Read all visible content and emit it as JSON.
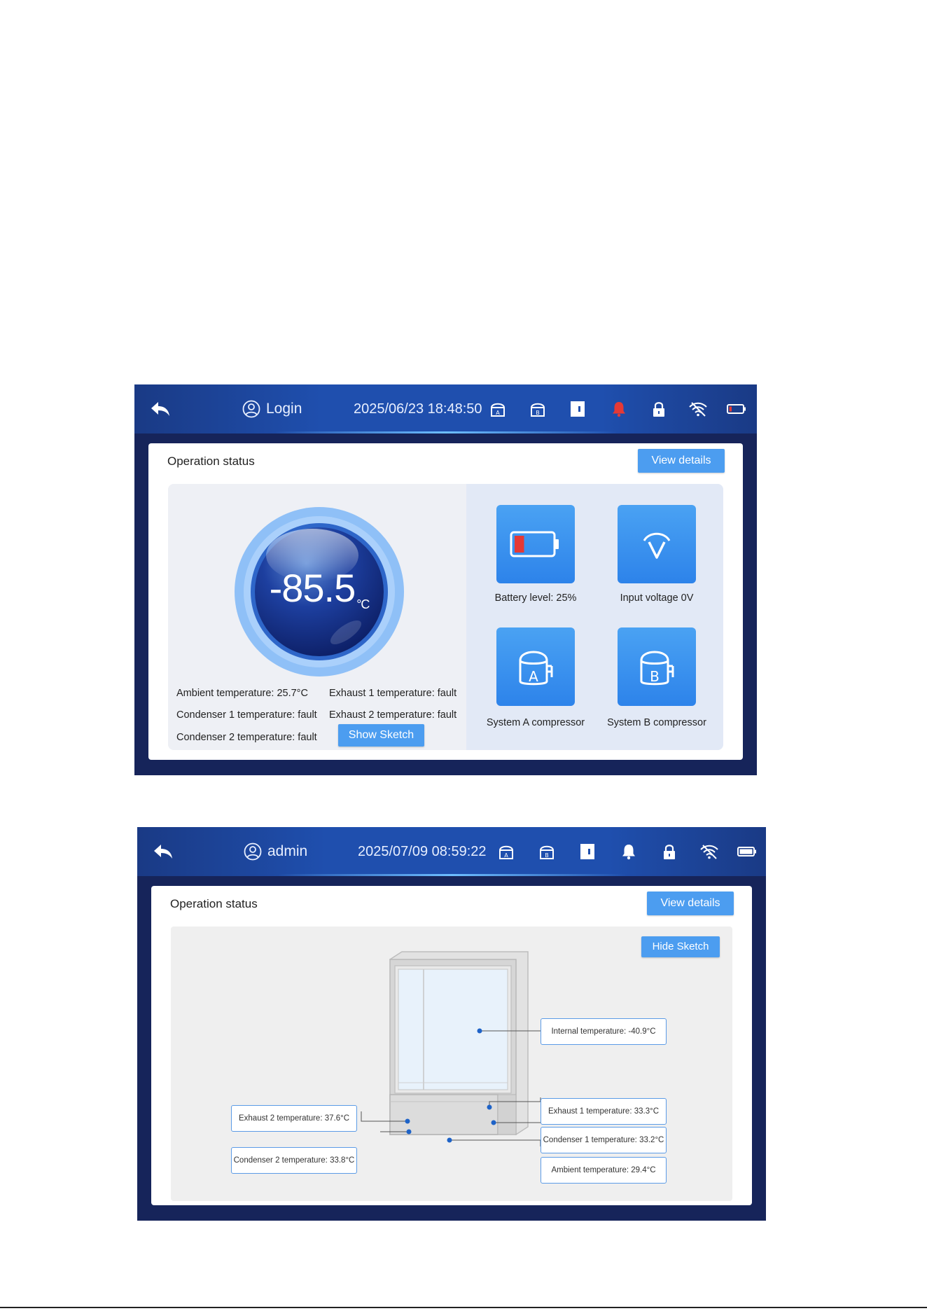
{
  "screen1": {
    "topbar": {
      "user": "Login",
      "datetime": "2025/06/23 18:48:50"
    },
    "panel": {
      "title": "Operation status",
      "view_details": "View details",
      "gauge": {
        "value": "-85.5",
        "unit": "°C"
      },
      "readouts": [
        "Ambient temperature: 25.7°C",
        "Exhaust 1 temperature: fault",
        "Condenser 1 temperature: fault",
        "Exhaust 2 temperature: fault",
        "Condenser 2 temperature: fault"
      ],
      "show_sketch": "Show Sketch",
      "tiles": [
        {
          "label": "Battery level: 25%",
          "icon": "battery-icon",
          "battery_level": 0.25
        },
        {
          "label": "Input voltage 0V",
          "icon": "voltage-icon"
        },
        {
          "label": "System A compressor",
          "icon": "compressor-a-icon",
          "letter": "A"
        },
        {
          "label": "System B compressor",
          "icon": "compressor-b-icon",
          "letter": "B"
        }
      ]
    },
    "status_icons": {
      "alarm_color": "#e53935"
    }
  },
  "screen2": {
    "topbar": {
      "user": "admin",
      "datetime": "2025/07/09 08:59:22"
    },
    "panel": {
      "title": "Operation status",
      "view_details": "View details",
      "hide_sketch": "Hide Sketch",
      "callouts": {
        "internal": "Internal temperature: -40.9°C",
        "exhaust1": "Exhaust 1 temperature: 33.3°C",
        "condenser1": "Condenser 1 temperature: 33.2°C",
        "ambient": "Ambient temperature: 29.4°C",
        "exhaust2": "Exhaust 2 temperature: 37.6°C",
        "condenser2": "Condenser 2 temperature: 33.8°C"
      }
    }
  },
  "colors": {
    "accent": "#4c9df0",
    "topbar": "#1f4fae",
    "frame": "#16245a"
  }
}
